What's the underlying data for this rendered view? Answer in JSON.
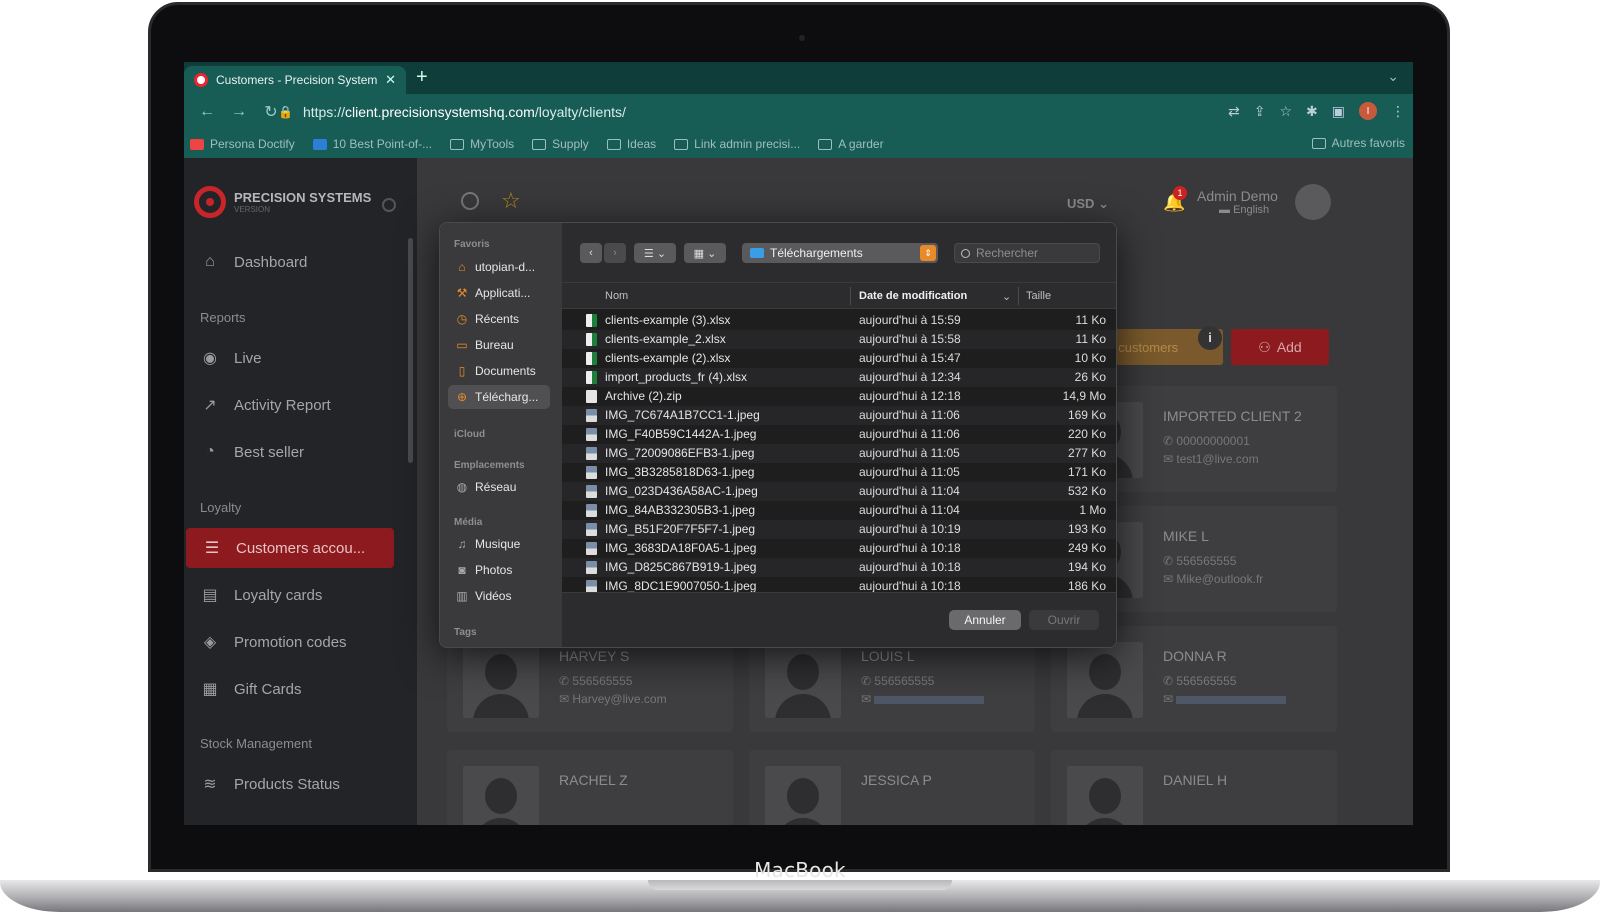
{
  "device": {
    "label": "MacBook"
  },
  "browser": {
    "tab_title": "Customers - Precision Systems",
    "url_prefix": "https://",
    "url_host": "client.precisionsystemshq.com",
    "url_path": "/loyalty/clients/",
    "profile_initial": "I",
    "bookmarks": [
      "Persona Doctify",
      "10 Best Point-of-...",
      "MyTools",
      "Supply",
      "Ideas",
      "Link admin precisi...",
      "A garder"
    ],
    "other_bookmarks": "Autres favoris"
  },
  "app": {
    "brand_name": "PRECISION SYSTEMS",
    "brand_sub": "VERSION",
    "sidebar": {
      "dashboard": "Dashboard",
      "reports_section": "Reports",
      "live": "Live",
      "activity_report": "Activity Report",
      "best_seller": "Best seller",
      "loyalty_section": "Loyalty",
      "customers_accounts": "Customers accou...",
      "loyalty_cards": "Loyalty cards",
      "promotion_codes": "Promotion codes",
      "gift_cards": "Gift Cards",
      "stock_section": "Stock Management",
      "products_status": "Products Status"
    },
    "topbar": {
      "currency": "USD",
      "notifications_count": "1",
      "admin_name": "Admin Demo",
      "admin_language": "English"
    },
    "actions": {
      "import_label": "t customers",
      "info": "i",
      "add_label": "Add"
    },
    "customers": [
      {
        "name": "IMPORTED CLIENT 2",
        "phone": "00000000001",
        "email": "test1@live.com"
      },
      {
        "name": "MIKE L",
        "phone": "556565555",
        "email": "Mike@outlook.fr"
      },
      {
        "name": "HARVEY S",
        "phone": "556565555",
        "email": "Harvey@live.com"
      },
      {
        "name": "LOUIS L",
        "phone": "556565555",
        "email": ""
      },
      {
        "name": "DONNA R",
        "phone": "556565555",
        "email": ""
      },
      {
        "name": "RACHEL Z",
        "phone": "",
        "email": ""
      },
      {
        "name": "JESSICA P",
        "phone": "",
        "email": ""
      },
      {
        "name": "DANIEL H",
        "phone": "",
        "email": ""
      }
    ]
  },
  "dialog": {
    "sidebar": {
      "favorites_header": "Favoris",
      "favorites": [
        "utopian-d...",
        "Applicati...",
        "Récents",
        "Bureau",
        "Documents",
        "Télécharg..."
      ],
      "icloud_header": "iCloud",
      "locations_header": "Emplacements",
      "network": "Réseau",
      "media_header": "Média",
      "music": "Musique",
      "photos": "Photos",
      "videos": "Vidéos",
      "tags_header": "Tags"
    },
    "location": "Téléchargements",
    "search_placeholder": "Rechercher",
    "columns": {
      "name": "Nom",
      "modified": "Date de modification",
      "size": "Taille"
    },
    "files": [
      {
        "name": "clients-example (3).xlsx",
        "date": "aujourd'hui à 15:59",
        "size": "11 Ko",
        "kind": "xlsx"
      },
      {
        "name": "clients-example_2.xlsx",
        "date": "aujourd'hui à 15:58",
        "size": "11 Ko",
        "kind": "xlsx"
      },
      {
        "name": "clients-example (2).xlsx",
        "date": "aujourd'hui à 15:47",
        "size": "10 Ko",
        "kind": "xlsx"
      },
      {
        "name": "import_products_fr (4).xlsx",
        "date": "aujourd'hui à 12:34",
        "size": "26 Ko",
        "kind": "xlsx"
      },
      {
        "name": "Archive (2).zip",
        "date": "aujourd'hui à 12:18",
        "size": "14,9 Mo",
        "kind": "zip"
      },
      {
        "name": "IMG_7C674A1B7CC1-1.jpeg",
        "date": "aujourd'hui à 11:06",
        "size": "169 Ko",
        "kind": "jpeg"
      },
      {
        "name": "IMG_F40B59C1442A-1.jpeg",
        "date": "aujourd'hui à 11:06",
        "size": "220 Ko",
        "kind": "jpeg"
      },
      {
        "name": "IMG_72009086EFB3-1.jpeg",
        "date": "aujourd'hui à 11:05",
        "size": "277 Ko",
        "kind": "jpeg"
      },
      {
        "name": "IMG_3B3285818D63-1.jpeg",
        "date": "aujourd'hui à 11:05",
        "size": "171 Ko",
        "kind": "jpeg"
      },
      {
        "name": "IMG_023D436A58AC-1.jpeg",
        "date": "aujourd'hui à 11:04",
        "size": "532 Ko",
        "kind": "jpeg"
      },
      {
        "name": "IMG_84AB332305B3-1.jpeg",
        "date": "aujourd'hui à 11:04",
        "size": "1 Mo",
        "kind": "jpeg"
      },
      {
        "name": "IMG_B51F20F7F5F7-1.jpeg",
        "date": "aujourd'hui à 10:19",
        "size": "193 Ko",
        "kind": "jpeg"
      },
      {
        "name": "IMG_3683DA18F0A5-1.jpeg",
        "date": "aujourd'hui à 10:18",
        "size": "249 Ko",
        "kind": "jpeg"
      },
      {
        "name": "IMG_D825C867B919-1.jpeg",
        "date": "aujourd'hui à 10:18",
        "size": "194 Ko",
        "kind": "jpeg"
      },
      {
        "name": "IMG_8DC1E9007050-1.jpeg",
        "date": "aujourd'hui à 10:18",
        "size": "186 Ko",
        "kind": "jpeg"
      }
    ],
    "cancel_label": "Annuler",
    "open_label": "Ouvrir"
  },
  "colors": {
    "accent_red": "#8d1a1e",
    "browser_teal": "#185c56",
    "finder_orange": "#e88a2a"
  }
}
